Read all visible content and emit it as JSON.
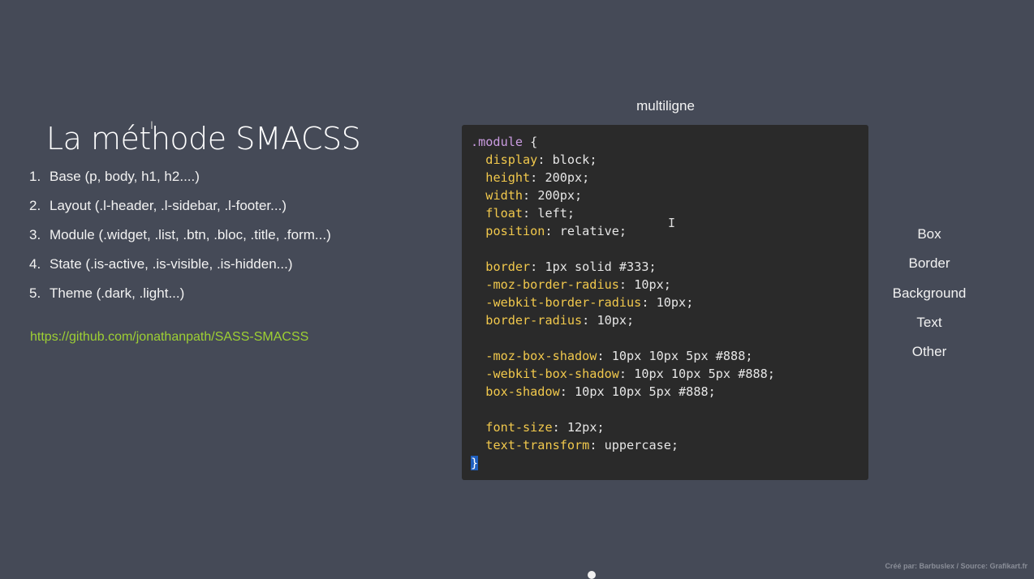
{
  "slide": {
    "title": "La méthode SMACSS",
    "list": [
      {
        "num": "1.",
        "text": "Base (p, body, h1, h2....)"
      },
      {
        "num": "2.",
        "text": "Layout (.l-header, .l-sidebar, .l-footer...)"
      },
      {
        "num": "3.",
        "text": "Module (.widget, .list, .btn, .bloc, .title, .form...)"
      },
      {
        "num": "4.",
        "text": "State (.is-active, .is-visible, .is-hidden...)"
      },
      {
        "num": "5.",
        "text": "Theme (.dark, .light...)"
      }
    ],
    "link": "https://github.com/jonathanpath/SASS-SMACSS"
  },
  "code": {
    "caption": "multiligne",
    "selector": ".module",
    "open_brace": " {",
    "close_brace": "}",
    "lines": [
      {
        "prop": "display",
        "value": "block;"
      },
      {
        "prop": "height",
        "value": "200px;"
      },
      {
        "prop": "width",
        "value": "200px;"
      },
      {
        "prop": "float",
        "value": "left;"
      },
      {
        "prop": "position",
        "value": "relative;"
      },
      {
        "prop": "",
        "value": ""
      },
      {
        "prop": "border",
        "value": "1px solid #333;"
      },
      {
        "prop": "-moz-border-radius",
        "value": "10px;"
      },
      {
        "prop": "-webkit-border-radius",
        "value": "10px;"
      },
      {
        "prop": "border-radius",
        "value": "10px;"
      },
      {
        "prop": "",
        "value": ""
      },
      {
        "prop": "-moz-box-shadow",
        "value": "10px 10px 5px #888;"
      },
      {
        "prop": "-webkit-box-shadow",
        "value": "10px 10px 5px #888;"
      },
      {
        "prop": "box-shadow",
        "value": "10px 10px 5px #888;"
      },
      {
        "prop": "",
        "value": ""
      },
      {
        "prop": "font-size",
        "value": "12px;"
      },
      {
        "prop": "text-transform",
        "value": "uppercase;"
      }
    ]
  },
  "right_nav": [
    "Box",
    "Border",
    "Background",
    "Text",
    "Other"
  ],
  "credit": "Créé par: Barbuslex / Source: Grafikart.fr",
  "colors": {
    "background": "#454a57",
    "code_background": "#2a2a2a",
    "link": "#9ed033",
    "property": "#f1c84c",
    "selector": "#c99be0",
    "selection": "#1f5fbf"
  }
}
